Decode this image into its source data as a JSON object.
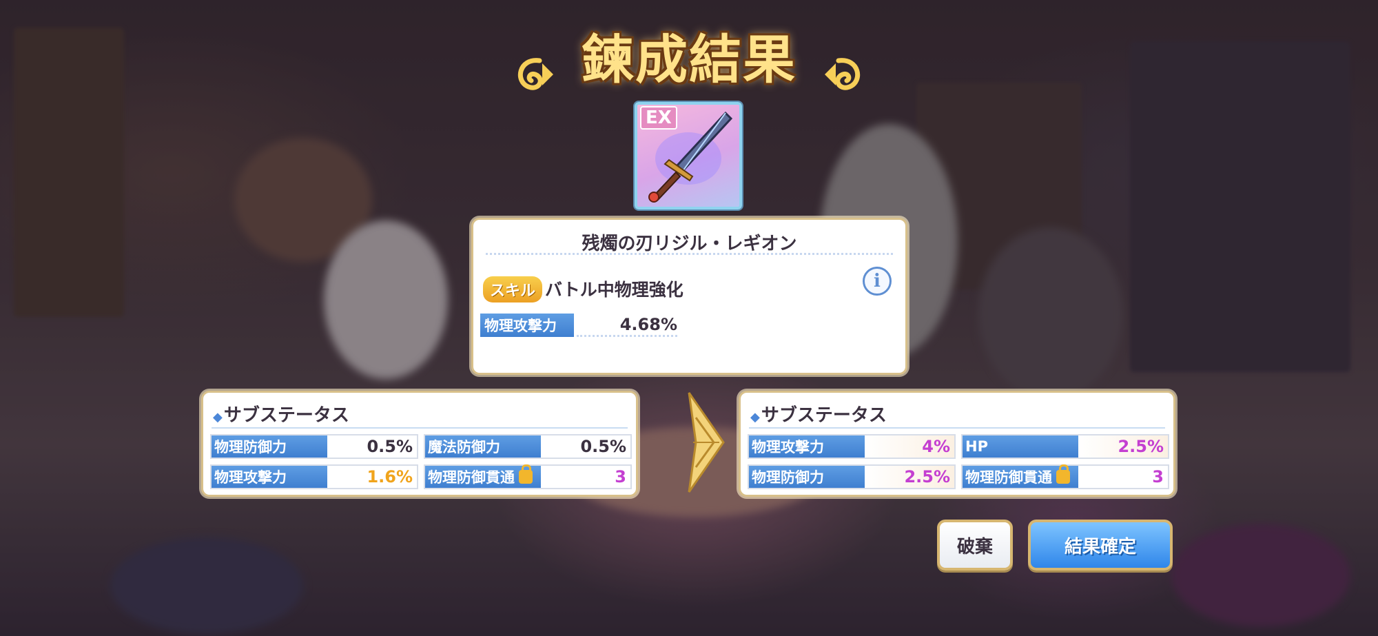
{
  "title": "鍊成結果",
  "equipment": {
    "rarity_tag": "EX",
    "name": "残燭の刃リジル・レギオン",
    "skill_badge": "スキル",
    "skill_name": "バトル中物理強化",
    "main_stat": {
      "label": "物理攻撃力",
      "value": "4.68%"
    }
  },
  "sub_status_before": {
    "heading": "サブステータス",
    "stats": [
      {
        "label": "物理防御力",
        "value": "0.5%",
        "color": "#3b3140"
      },
      {
        "label": "魔法防御力",
        "value": "0.5%",
        "color": "#3b3140"
      },
      {
        "label": "物理攻撃力",
        "value": "1.6%",
        "color": "#f0a41c"
      },
      {
        "label": "物理防御貫通",
        "value": "3",
        "color": "#c43fd1",
        "locked": true
      }
    ]
  },
  "sub_status_after": {
    "heading": "サブステータス",
    "stats": [
      {
        "label": "物理攻撃力",
        "value": "4%",
        "color": "#c43fd1"
      },
      {
        "label": "HP",
        "value": "2.5%",
        "color": "#c43fd1"
      },
      {
        "label": "物理防御力",
        "value": "2.5%",
        "color": "#c43fd1"
      },
      {
        "label": "物理防御貫通",
        "value": "3",
        "color": "#c43fd1",
        "locked": true
      }
    ]
  },
  "buttons": {
    "discard": "破棄",
    "confirm": "結果確定"
  }
}
